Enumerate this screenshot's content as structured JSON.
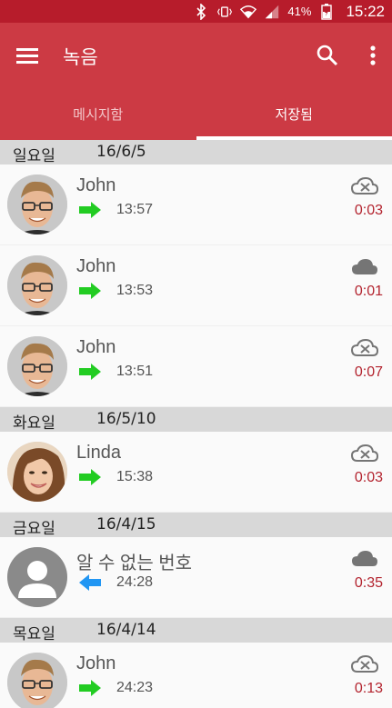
{
  "status_bar": {
    "battery_percent": "41%",
    "time": "15:22"
  },
  "app_bar": {
    "title": "녹음"
  },
  "tabs": [
    {
      "label": "메시지함",
      "active": false
    },
    {
      "label": "저장됨",
      "active": true
    }
  ],
  "groups": [
    {
      "day": "일요일",
      "date": "16/6/5",
      "items": [
        {
          "name": "John",
          "direction": "outgoing",
          "time": "13:57",
          "duration": "0:03",
          "cloud": "cloud-off-icon",
          "avatar": "john"
        },
        {
          "name": "John",
          "direction": "outgoing",
          "time": "13:53",
          "duration": "0:01",
          "cloud": "cloud-icon",
          "avatar": "john"
        },
        {
          "name": "John",
          "direction": "outgoing",
          "time": "13:51",
          "duration": "0:07",
          "cloud": "cloud-off-icon",
          "avatar": "john"
        }
      ]
    },
    {
      "day": "화요일",
      "date": "16/5/10",
      "items": [
        {
          "name": "Linda",
          "direction": "outgoing",
          "time": "15:38",
          "duration": "0:03",
          "cloud": "cloud-off-icon",
          "avatar": "linda"
        }
      ]
    },
    {
      "day": "금요일",
      "date": "16/4/15",
      "items": [
        {
          "name": "알 수 없는 번호",
          "direction": "incoming",
          "time": "24:28",
          "duration": "0:35",
          "cloud": "cloud-icon",
          "avatar": "unknown"
        }
      ]
    },
    {
      "day": "목요일",
      "date": "16/4/14",
      "items": [
        {
          "name": "John",
          "direction": "outgoing",
          "time": "24:23",
          "duration": "0:13",
          "cloud": "cloud-off-icon",
          "avatar": "john"
        }
      ]
    }
  ],
  "colors": {
    "status_bar": "#b71c2b",
    "app_bar": "#cc3a44",
    "outgoing_arrow": "#22cc22",
    "incoming_arrow": "#2196f3",
    "duration_text": "#b3232e"
  }
}
